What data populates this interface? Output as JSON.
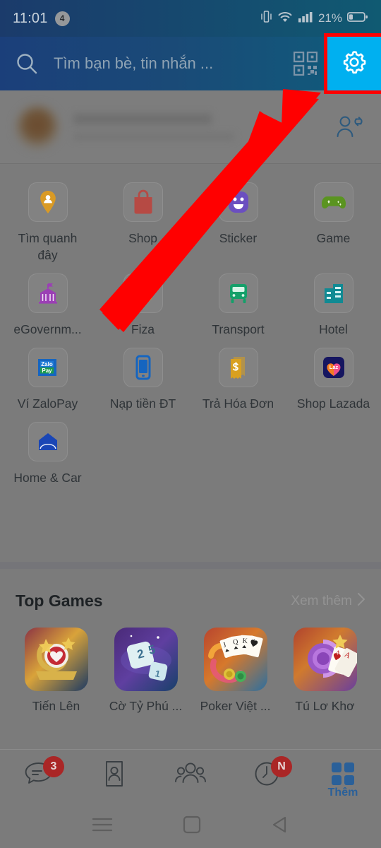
{
  "status_bar": {
    "time": "11:01",
    "notification_count": "4",
    "battery_percent": "21%",
    "icons": [
      "vibrate-icon",
      "wifi-icon",
      "signal-icon",
      "battery-icon"
    ]
  },
  "header": {
    "search_placeholder": "Tìm bạn bè, tin nhắn ...",
    "search_icon": "search-icon",
    "qr_icon": "qr-code-icon",
    "settings_icon": "gear-icon",
    "settings_highlight_color": "#00b0f0",
    "highlight_border_color": "#ff0000"
  },
  "profile": {
    "name": "",
    "subtitle": "",
    "action_icon": "add-friend-icon"
  },
  "app_grid": [
    {
      "label": "Tìm quanh\nđây",
      "icon": "location-pin-person-icon",
      "color": "#d99a25"
    },
    {
      "label": "Shop",
      "icon": "shopping-bag-icon",
      "color": "#b64a44"
    },
    {
      "label": "Sticker",
      "icon": "smiley-sticker-icon",
      "color": "#6b4fc0"
    },
    {
      "label": "Game",
      "icon": "gamepad-icon",
      "color": "#5a9420"
    },
    {
      "label": "eGovernm...",
      "icon": "government-building-icon",
      "color": "#9b3fb5"
    },
    {
      "label": "Fiza",
      "icon": "dollar-coin-icon",
      "color": "#d9a020"
    },
    {
      "label": "Transport",
      "icon": "bus-icon",
      "color": "#15a06a"
    },
    {
      "label": "Hotel",
      "icon": "hotel-building-icon",
      "color": "#108a93"
    },
    {
      "label": "Ví ZaloPay",
      "icon": "zalopay-wallet-icon",
      "color": "#1565c0"
    },
    {
      "label": "Nạp tiền ĐT",
      "icon": "mobile-topup-icon",
      "color": "#1565c0"
    },
    {
      "label": "Trả Hóa Đơn",
      "icon": "invoice-bill-icon",
      "color": "#d9a020"
    },
    {
      "label": "Shop Lazada",
      "icon": "lazada-shop-icon",
      "color": "#1a1a66"
    },
    {
      "label": "Home & Car",
      "icon": "home-car-icon",
      "color": "#1a46b5"
    }
  ],
  "top_games": {
    "title": "Top Games",
    "more_label": "Xem thêm",
    "more_icon": "chevron-right-icon",
    "items": [
      {
        "name": "Tiến Lên",
        "thumb": "tien-len-game-thumb"
      },
      {
        "name": "Cờ Tỷ Phú ...",
        "thumb": "co-ty-phu-game-thumb"
      },
      {
        "name": "Poker Việt ...",
        "thumb": "poker-viet-game-thumb"
      },
      {
        "name": "Tú Lơ Khơ",
        "thumb": "tu-lo-kho-game-thumb"
      }
    ]
  },
  "tab_bar": {
    "active_color": "#2a6099",
    "badge_color": "#aa2626",
    "items": [
      {
        "label": "",
        "icon": "message-bubble-icon",
        "badge": "3",
        "active": false
      },
      {
        "label": "",
        "icon": "contacts-card-icon",
        "badge": "",
        "active": false
      },
      {
        "label": "",
        "icon": "people-group-icon",
        "badge": "",
        "active": false
      },
      {
        "label": "",
        "icon": "clock-timeline-icon",
        "badge": "N",
        "active": false
      },
      {
        "label": "Thêm",
        "icon": "grid-squares-icon",
        "badge": "",
        "active": true
      }
    ]
  },
  "system_nav": {
    "recents_icon": "hamburger-recents-icon",
    "home_icon": "square-home-icon",
    "back_icon": "triangle-back-icon"
  },
  "annotation": {
    "arrow_color": "#ff0000",
    "arrow_from": "140,440",
    "arrow_to": "455,130"
  }
}
